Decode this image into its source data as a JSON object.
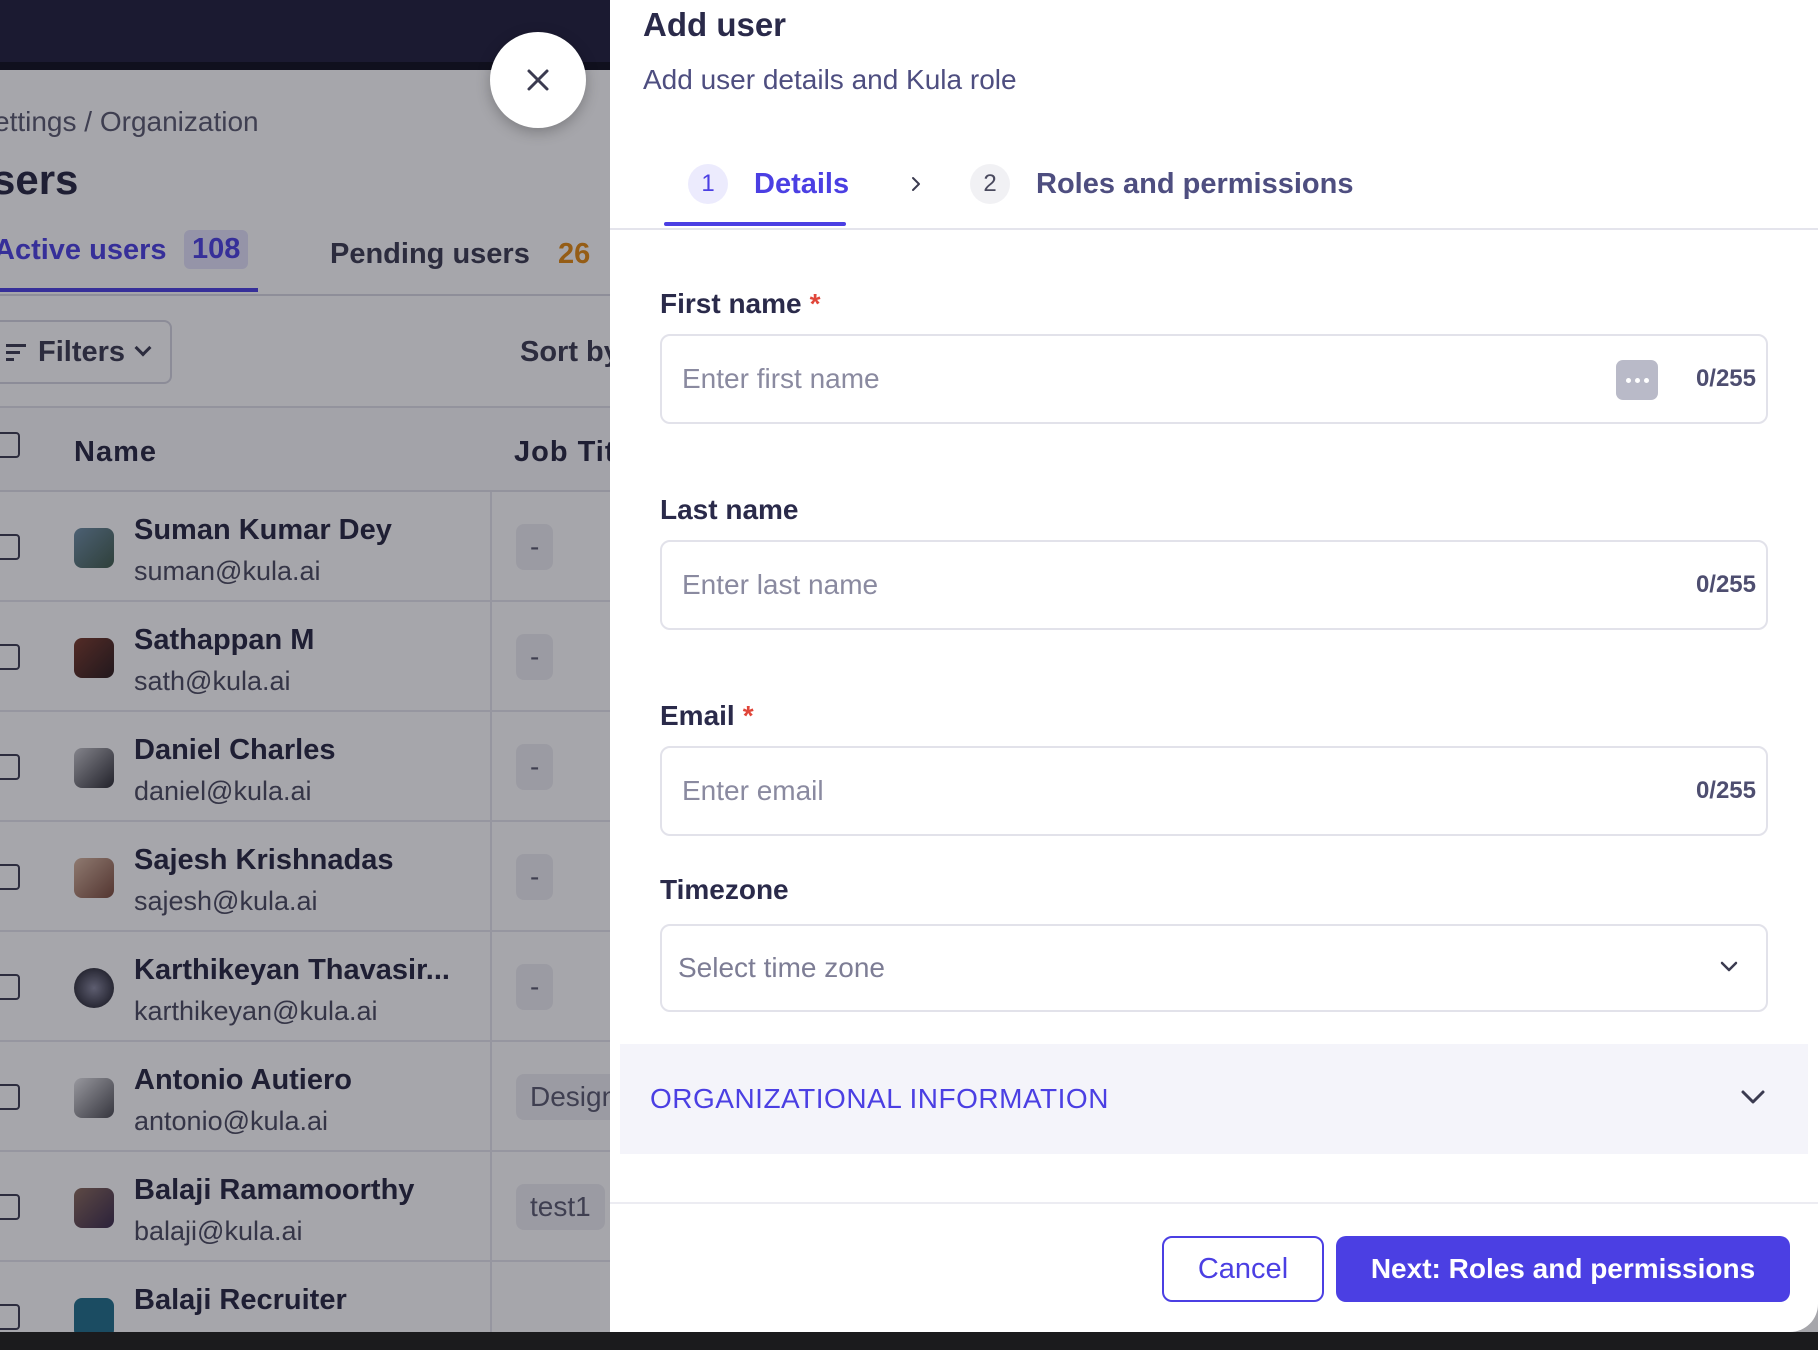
{
  "background": {
    "breadcrumb": "ettings / Organization",
    "page_title": "sers",
    "tabs": {
      "active_label": "Active users",
      "active_count": "108",
      "pending_label": "Pending users",
      "pending_count": "26"
    },
    "filters_label": "Filters",
    "sort_label": "Sort by",
    "table": {
      "headers": {
        "name": "Name",
        "job_title": "Job Tit"
      },
      "rows": [
        {
          "name": "Suman Kumar Dey",
          "email": "suman@kula.ai",
          "job": "-"
        },
        {
          "name": "Sathappan M",
          "email": "sath@kula.ai",
          "job": "-"
        },
        {
          "name": "Daniel Charles",
          "email": "daniel@kula.ai",
          "job": "-"
        },
        {
          "name": "Sajesh Krishnadas",
          "email": "sajesh@kula.ai",
          "job": "-"
        },
        {
          "name": "Karthikeyan Thavasir...",
          "email": "karthikeyan@kula.ai",
          "job": "-"
        },
        {
          "name": "Antonio Autiero",
          "email": "antonio@kula.ai",
          "job": "Design"
        },
        {
          "name": "Balaji Ramamoorthy",
          "email": "balaji@kula.ai",
          "job": "test1"
        },
        {
          "name": "Balaji Recruiter",
          "email": "",
          "job": ""
        }
      ]
    }
  },
  "drawer": {
    "title": "Add user",
    "subtitle": "Add user details and Kula role",
    "steps": [
      {
        "number": "1",
        "label": "Details",
        "active": true
      },
      {
        "number": "2",
        "label": "Roles and permissions",
        "active": false
      }
    ],
    "fields": {
      "first_name": {
        "label": "First name",
        "required": "*",
        "placeholder": "Enter first name",
        "counter": "0/255"
      },
      "last_name": {
        "label": "Last name",
        "placeholder": "Enter last name",
        "counter": "0/255"
      },
      "email": {
        "label": "Email",
        "required": "*",
        "placeholder": "Enter email",
        "counter": "0/255"
      },
      "timezone": {
        "label": "Timezone",
        "placeholder": "Select time zone"
      }
    },
    "section_label": "ORGANIZATIONAL INFORMATION",
    "buttons": {
      "cancel": "Cancel",
      "next": "Next: Roles and permissions"
    }
  },
  "colors": {
    "accent": "#4b3fe3",
    "required": "#e0463a",
    "pending_count": "#e48a10"
  },
  "icons": {
    "close": "close-icon",
    "step_chevron": "chevron-right-icon",
    "select_chevron": "chevron-down-icon",
    "password_manager": "more-dots-icon"
  }
}
